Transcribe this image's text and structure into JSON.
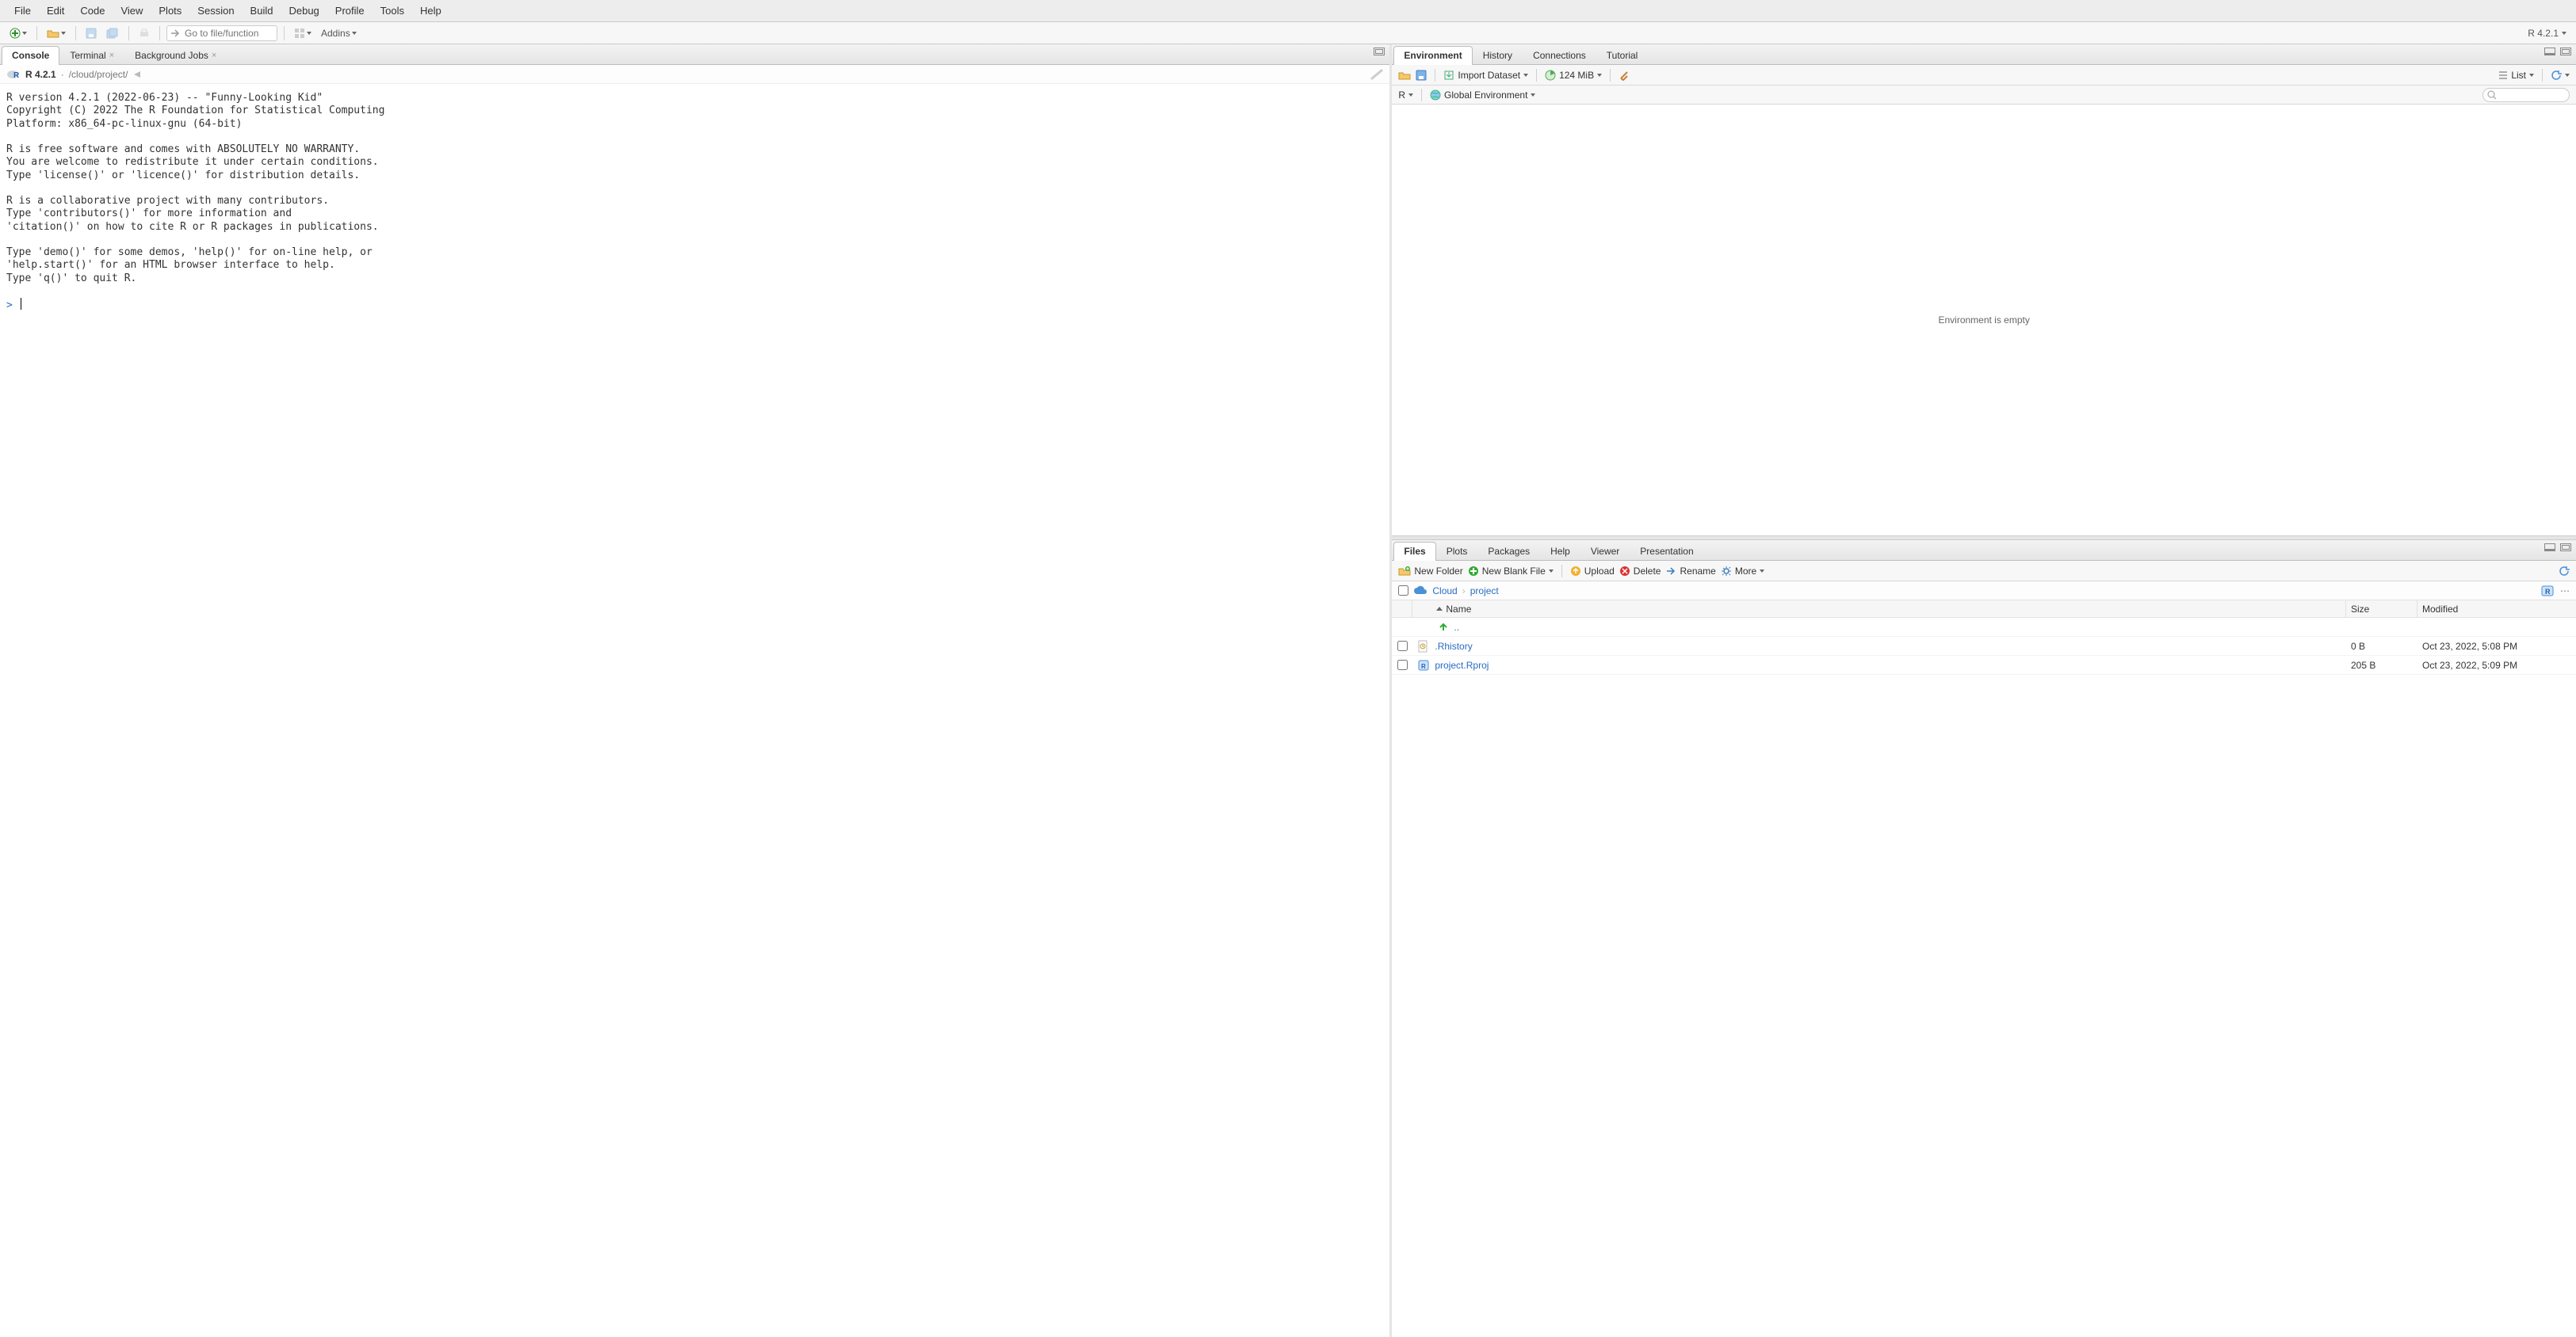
{
  "menu": [
    "File",
    "Edit",
    "Code",
    "View",
    "Plots",
    "Session",
    "Build",
    "Debug",
    "Profile",
    "Tools",
    "Help"
  ],
  "toolbar": {
    "goto_placeholder": "Go to file/function",
    "addins_label": "Addins",
    "r_version": "R 4.2.1"
  },
  "left": {
    "tabs": [
      "Console",
      "Terminal",
      "Background Jobs"
    ],
    "active_tab": 0,
    "console": {
      "lang": "R 4.2.1",
      "path": "/cloud/project/",
      "text": "R version 4.2.1 (2022-06-23) -- \"Funny-Looking Kid\"\nCopyright (C) 2022 The R Foundation for Statistical Computing\nPlatform: x86_64-pc-linux-gnu (64-bit)\n\nR is free software and comes with ABSOLUTELY NO WARRANTY.\nYou are welcome to redistribute it under certain conditions.\nType 'license()' or 'licence()' for distribution details.\n\nR is a collaborative project with many contributors.\nType 'contributors()' for more information and\n'citation()' on how to cite R or R packages in publications.\n\nType 'demo()' for some demos, 'help()' for on-line help, or\n'help.start()' for an HTML browser interface to help.\nType 'q()' to quit R.\n",
      "prompt": ">"
    }
  },
  "right_top": {
    "tabs": [
      "Environment",
      "History",
      "Connections",
      "Tutorial"
    ],
    "active_tab": 0,
    "bar": {
      "import_label": "Import Dataset",
      "memory_label": "124 MiB",
      "list_label": "List",
      "scope_letter": "R",
      "scope_label": "Global Environment"
    },
    "empty_text": "Environment is empty"
  },
  "right_bottom": {
    "tabs": [
      "Files",
      "Plots",
      "Packages",
      "Help",
      "Viewer",
      "Presentation"
    ],
    "active_tab": 0,
    "bar": {
      "new_folder": "New Folder",
      "new_blank": "New Blank File",
      "upload": "Upload",
      "delete": "Delete",
      "rename": "Rename",
      "more": "More"
    },
    "breadcrumb": [
      "Cloud",
      "project"
    ],
    "columns": {
      "name": "Name",
      "size": "Size",
      "modified": "Modified"
    },
    "updir": "..",
    "rows": [
      {
        "name": ".Rhistory",
        "size": "0 B",
        "modified": "Oct 23, 2022, 5:08 PM",
        "icon": "history"
      },
      {
        "name": "project.Rproj",
        "size": "205 B",
        "modified": "Oct 23, 2022, 5:09 PM",
        "icon": "rproj"
      }
    ]
  }
}
